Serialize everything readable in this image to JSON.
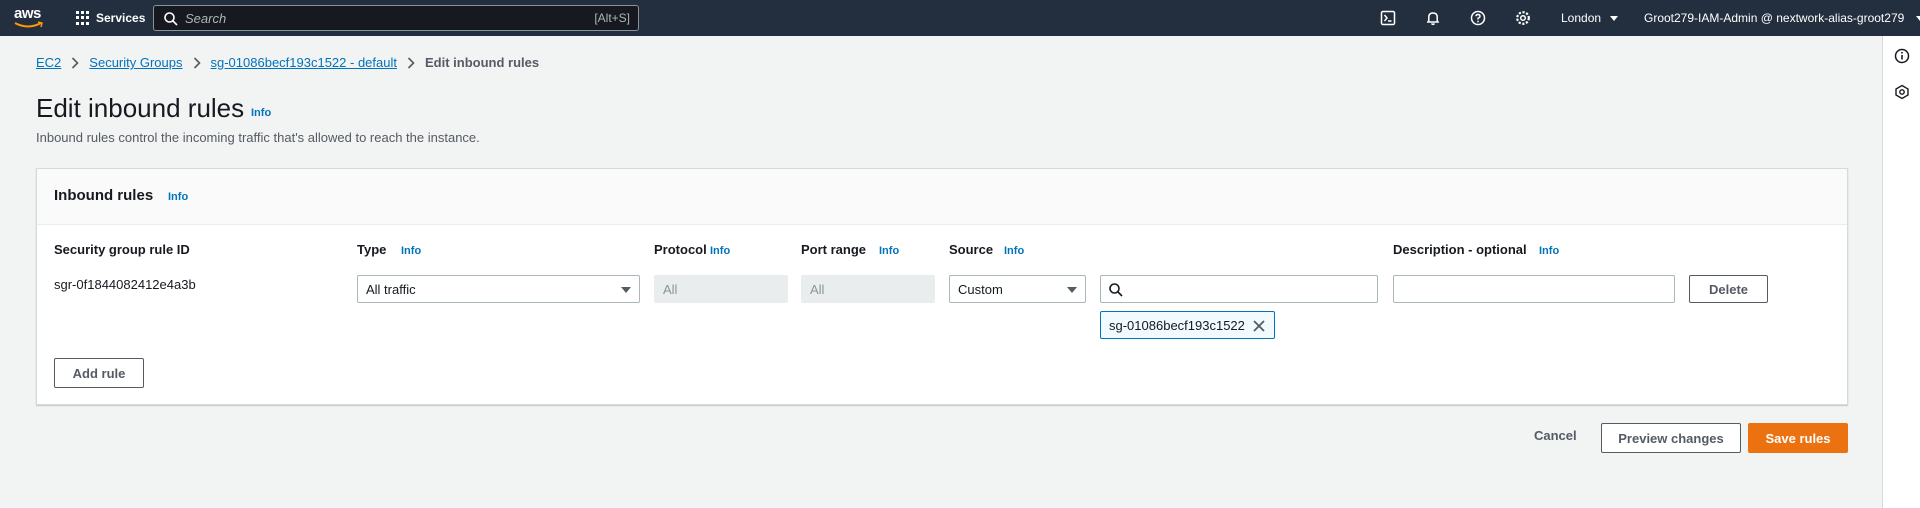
{
  "topnav": {
    "logo_text": "aws",
    "services_label": "Services",
    "search_placeholder": "Search",
    "search_shortcut": "[Alt+S]",
    "icons": [
      "cloudshell-icon",
      "bell-icon",
      "help-icon",
      "gear-icon"
    ],
    "region": "London",
    "account": "Groot279-IAM-Admin @ nextwork-alias-groot279"
  },
  "breadcrumb": {
    "items": [
      "EC2",
      "Security Groups",
      "sg-01086becf193c1522 - default"
    ],
    "current": "Edit inbound rules"
  },
  "page": {
    "title": "Edit inbound rules",
    "title_info": "Info",
    "description": "Inbound rules control the incoming traffic that's allowed to reach the instance."
  },
  "panel": {
    "title": "Inbound rules",
    "info": "Info",
    "columns": {
      "rule_id": "Security group rule ID",
      "type": "Type",
      "protocol": "Protocol",
      "port_range": "Port range",
      "source": "Source",
      "description": "Description - optional"
    },
    "col_info": "Info",
    "rule": {
      "id": "sgr-0f1844082412e4a3b",
      "type": "All traffic",
      "protocol": "All",
      "port_range": "All",
      "source": "Custom",
      "source_search_value": "",
      "source_token": "sg-01086becf193c1522",
      "description_value": "",
      "delete_label": "Delete"
    },
    "add_rule_label": "Add rule"
  },
  "footer": {
    "cancel_label": "Cancel",
    "preview_label": "Preview changes",
    "save_label": "Save rules"
  },
  "colors": {
    "nav_bg": "#232f3e",
    "link": "#0073bb",
    "primary": "#ec7211"
  }
}
